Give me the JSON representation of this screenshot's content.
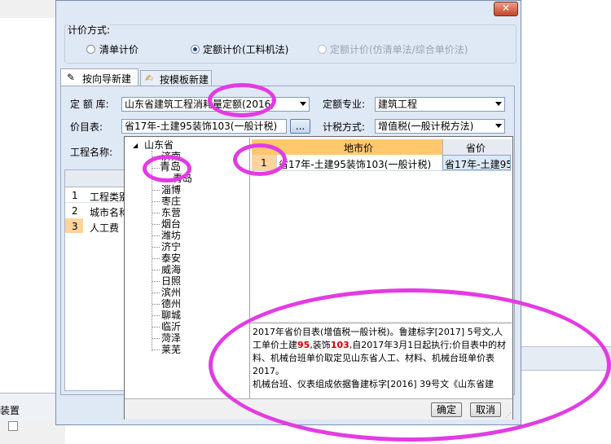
{
  "pricing_method": {
    "group_title": "计价方式:",
    "options": [
      "清单计价",
      "定额计价(工料机法)",
      "定额计价(仿清单法/综合单价法)"
    ],
    "selected_index": 1
  },
  "tabs": [
    "按向导新建",
    "按模板新建"
  ],
  "form": {
    "quota_lib_label": "定 额 库:",
    "quota_lib_value": "山东省建筑工程消耗量定额(2016)",
    "quota_major_label": "定额专业:",
    "quota_major_value": "建筑工程",
    "price_list_label": "价目表:",
    "price_list_value": "省17年-土建95装饰103(一般计税)",
    "browse_label": "...",
    "tax_method_label": "计税方式:",
    "tax_method_value": "增值税(一般计税方法)",
    "project_name_label": "工程名称:"
  },
  "tree": {
    "root": "山东省",
    "children": [
      "济南",
      "青岛",
      "青岛",
      "淄博",
      "枣庄",
      "东营",
      "烟台",
      "潍坊",
      "济宁",
      "泰安",
      "威海",
      "日照",
      "滨州",
      "德州",
      "聊城",
      "临沂",
      "菏泽",
      "莱芜"
    ]
  },
  "price_table": {
    "headers": [
      "",
      "地市价",
      "省价"
    ],
    "rows": [
      [
        "1",
        "省17年-土建95装饰103(一般计税)",
        "省17年-土建95"
      ]
    ]
  },
  "description": {
    "p1": "2017年省价目表(增值税一般计税)。鲁建标字[2017] 5号文,人工单价土建",
    "n1": "95",
    "p2": ",装饰",
    "n2": "103",
    "p3": ",自2017年3月1日起执行;价目表中的材料、机械台班单价取定见山东省人工、材料、机械台班单价表2017。",
    "p4": "机械台班、仪表组成依据鲁建标字[2016] 39号文《山东省建"
  },
  "bg_table": {
    "rows": [
      [
        "1",
        "工程类别"
      ],
      [
        "2",
        "城市名称"
      ],
      [
        "3",
        "人工费"
      ]
    ]
  },
  "buttons": {
    "ok": "确定",
    "cancel": "取消"
  },
  "left_bottom_label": "装置",
  "colors": {
    "highlight": "#ffd39b",
    "annotation": "#e33be3",
    "header": "#ffc86e"
  }
}
